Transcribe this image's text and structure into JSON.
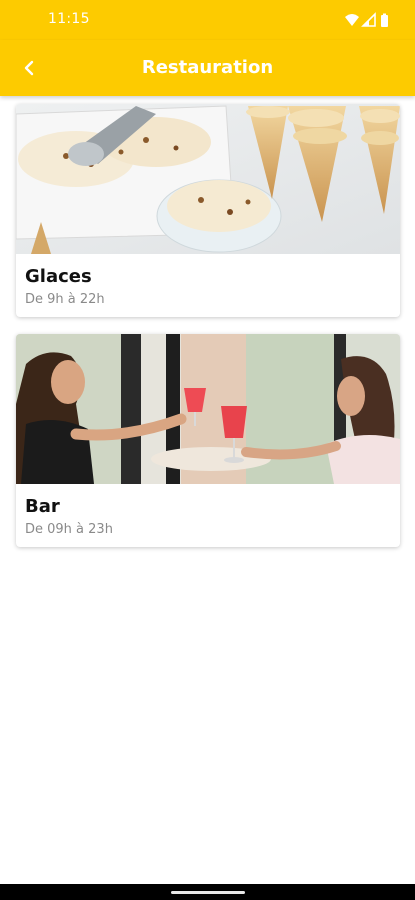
{
  "status": {
    "time": "11:15",
    "icons": [
      "wifi-icon",
      "signal-icon",
      "battery-icon"
    ]
  },
  "appbar": {
    "title": "Restauration",
    "back_icon": "chevron-left-icon",
    "color": "#fdcb00"
  },
  "items": [
    {
      "title": "Glaces",
      "hours": "De 9h à 22h",
      "image": "ice-cream-photo"
    },
    {
      "title": "Bar",
      "hours": "De 09h à 23h",
      "image": "bar-cocktails-photo"
    }
  ]
}
